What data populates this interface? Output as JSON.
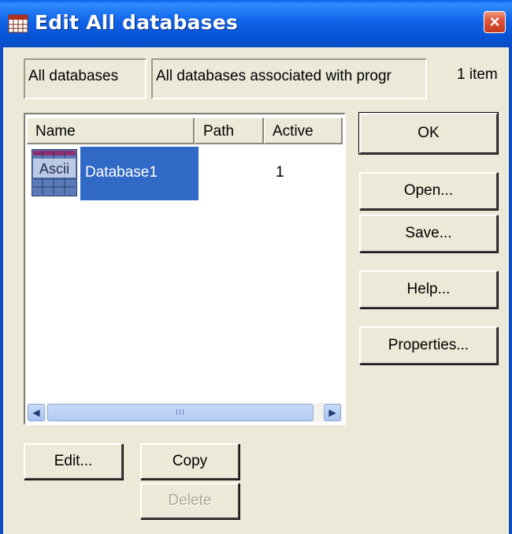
{
  "window": {
    "title": "Edit All databases",
    "icon": "database-grid-icon",
    "close_label": "×"
  },
  "header": {
    "name_field": "All databases",
    "description_field": "All databases associated with progr",
    "item_count": "1 item"
  },
  "list": {
    "columns": [
      "Name",
      "Path",
      "Active"
    ],
    "rows": [
      {
        "icon_label": "Ascii",
        "name": "Database1",
        "path": "",
        "active": "1"
      }
    ],
    "scrollbar_grip": "III"
  },
  "buttons": {
    "ok": "OK",
    "open": "Open...",
    "save": "Save...",
    "help": "Help...",
    "properties": "Properties...",
    "edit": "Edit...",
    "copy": "Copy",
    "delete": "Delete"
  },
  "colors": {
    "titlebar": "#0a5fe6",
    "selection": "#3169c6",
    "dialog_bg": "#ece9d8"
  }
}
